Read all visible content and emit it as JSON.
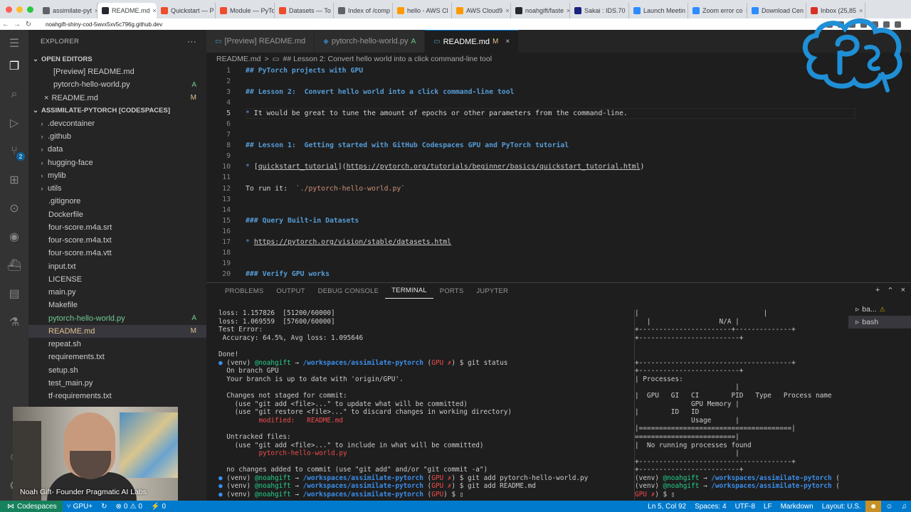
{
  "browser": {
    "tabs": [
      {
        "title": "assimilate-pyt",
        "color": "#5f6368"
      },
      {
        "title": "README.md",
        "color": "#24292f",
        "active": true
      },
      {
        "title": "Quickstart — P",
        "color": "#ee4c2c"
      },
      {
        "title": "Module — PyTo",
        "color": "#ee4c2c"
      },
      {
        "title": "Datasets — To",
        "color": "#ee4c2c"
      },
      {
        "title": "Index of /comp",
        "color": "#5f6368"
      },
      {
        "title": "hello - AWS Cl",
        "color": "#ff9900"
      },
      {
        "title": "AWS Cloud9",
        "color": "#ff9900"
      },
      {
        "title": "noahgift/faste",
        "color": "#24292f"
      },
      {
        "title": "Sakai : IDS.70",
        "color": "#1a237e"
      },
      {
        "title": "Launch Meetin",
        "color": "#2d8cff"
      },
      {
        "title": "Zoom error co",
        "color": "#2d8cff"
      },
      {
        "title": "Download Cen",
        "color": "#2d8cff"
      },
      {
        "title": "Inbox (25,85",
        "color": "#d93025"
      }
    ],
    "url": "noahgift-shiny-cod-5wvx5xv5c796g.github.dev"
  },
  "activity": {
    "source_control_badge": "2"
  },
  "explorer": {
    "title": "EXPLORER",
    "more": "···",
    "open_editors_label": "OPEN EDITORS",
    "open_editors": [
      {
        "name": "[Preview] README.md",
        "status": ""
      },
      {
        "name": "pytorch-hello-world.py",
        "status": "A"
      },
      {
        "name": "README.md",
        "status": "M",
        "close": "×"
      }
    ],
    "workspace_label": "ASSIMILATE-PYTORCH [CODESPACES]",
    "folders": [
      ".devcontainer",
      ".github",
      "data",
      "hugging-face",
      "mylib",
      "utils"
    ],
    "files": [
      {
        "name": ".gitignore",
        "status": ""
      },
      {
        "name": "Dockerfile",
        "status": ""
      },
      {
        "name": "four-score.m4a.srt",
        "status": ""
      },
      {
        "name": "four-score.m4a.txt",
        "status": ""
      },
      {
        "name": "four-score.m4a.vtt",
        "status": ""
      },
      {
        "name": "input.txt",
        "status": ""
      },
      {
        "name": "LICENSE",
        "status": ""
      },
      {
        "name": "main.py",
        "status": ""
      },
      {
        "name": "Makefile",
        "status": ""
      },
      {
        "name": "pytorch-hello-world.py",
        "status": "A"
      },
      {
        "name": "README.md",
        "status": "M"
      },
      {
        "name": "repeat.sh",
        "status": ""
      },
      {
        "name": "requirements.txt",
        "status": ""
      },
      {
        "name": "setup.sh",
        "status": ""
      },
      {
        "name": "test_main.py",
        "status": ""
      },
      {
        "name": "tf-requirements.txt",
        "status": ""
      }
    ]
  },
  "editor": {
    "tabs": [
      {
        "label": "[Preview] README.md",
        "mod": ""
      },
      {
        "label": "pytorch-hello-world.py",
        "mod": "A"
      },
      {
        "label": "README.md",
        "mod": "M",
        "active": true
      }
    ],
    "breadcrumb_file": "README.md",
    "breadcrumb_sep": ">",
    "breadcrumb_section": "## Lesson 2:  Convert hello world into a click command-line tool",
    "lines": [
      {
        "n": "1",
        "parts": [
          [
            "md-h",
            "## PyTorch projects with GPU"
          ]
        ]
      },
      {
        "n": "2",
        "parts": []
      },
      {
        "n": "3",
        "parts": [
          [
            "md-h",
            "## Lesson 2:  Convert hello world into a click command-line tool"
          ]
        ]
      },
      {
        "n": "4",
        "parts": []
      },
      {
        "n": "5",
        "parts": [
          [
            "md-b",
            "*"
          ],
          [
            "",
            " It would be great to tune the amount of epochs or other parameters from the command-line."
          ]
        ],
        "current": true
      },
      {
        "n": "6",
        "parts": []
      },
      {
        "n": "7",
        "parts": []
      },
      {
        "n": "8",
        "parts": [
          [
            "md-h",
            "## Lesson 1:  Getting started with GitHub Codespaces GPU and PyTorch tutorial"
          ]
        ]
      },
      {
        "n": "9",
        "parts": []
      },
      {
        "n": "10",
        "parts": [
          [
            "md-b",
            "*"
          ],
          [
            "",
            " ["
          ],
          [
            "md-link",
            "quickstart_tutorial"
          ],
          [
            "",
            "]("
          ],
          [
            "md-link",
            "https://pytorch.org/tutorials/beginner/basics/quickstart_tutorial.html"
          ],
          [
            "",
            ")"
          ]
        ]
      },
      {
        "n": "11",
        "parts": []
      },
      {
        "n": "12",
        "parts": [
          [
            "",
            "To run it:  "
          ],
          [
            "md-code",
            "`./pytorch-hello-world.py`"
          ]
        ]
      },
      {
        "n": "13",
        "parts": []
      },
      {
        "n": "14",
        "parts": []
      },
      {
        "n": "15",
        "parts": [
          [
            "md-h",
            "### Query Built-in Datasets"
          ]
        ]
      },
      {
        "n": "16",
        "parts": []
      },
      {
        "n": "17",
        "parts": [
          [
            "md-b",
            "*"
          ],
          [
            "",
            " "
          ],
          [
            "md-link",
            "https://pytorch.org/vision/stable/datasets.html"
          ]
        ]
      },
      {
        "n": "18",
        "parts": []
      },
      {
        "n": "19",
        "parts": []
      },
      {
        "n": "20",
        "parts": [
          [
            "md-h",
            "### Verify GPU works"
          ]
        ]
      }
    ]
  },
  "panel": {
    "tabs": [
      "PROBLEMS",
      "OUTPUT",
      "DEBUG CONSOLE",
      "TERMINAL",
      "PORTS",
      "JUPYTER"
    ],
    "active_tab": "TERMINAL",
    "terminal_left": [
      [
        [
          "",
          "loss: 1.157826  [51200/60000]"
        ]
      ],
      [
        [
          "",
          "loss: 1.069559  [57600/60000]"
        ]
      ],
      [
        [
          "",
          "Test Error:"
        ]
      ],
      [
        [
          "",
          " Accuracy: 64.5%, Avg loss: 1.095646"
        ]
      ],
      [
        [
          "",
          ""
        ]
      ],
      [
        [
          "",
          "Done!"
        ]
      ],
      [
        [
          "dot",
          "●"
        ],
        [
          "",
          " (venv) "
        ],
        [
          "t-green",
          "@noahgift"
        ],
        [
          "",
          " → "
        ],
        [
          "t-bold-blue",
          "/workspaces/assimilate-pytorch"
        ],
        [
          "",
          " ("
        ],
        [
          "t-red",
          "GPU ✗"
        ],
        [
          "",
          ") $ git status"
        ]
      ],
      [
        [
          "",
          "  On branch GPU"
        ]
      ],
      [
        [
          "",
          "  Your branch is up to date with 'origin/GPU'."
        ]
      ],
      [
        [
          "",
          ""
        ]
      ],
      [
        [
          "",
          "  Changes not staged for commit:"
        ]
      ],
      [
        [
          "",
          "    (use \"git add <file>...\" to update what will be committed)"
        ]
      ],
      [
        [
          "",
          "    (use \"git restore <file>...\" to discard changes in working directory)"
        ]
      ],
      [
        [
          "",
          "          "
        ],
        [
          "t-red",
          "modified:   README.md"
        ]
      ],
      [
        [
          "",
          ""
        ]
      ],
      [
        [
          "",
          "  Untracked files:"
        ]
      ],
      [
        [
          "",
          "    (use \"git add <file>...\" to include in what will be committed)"
        ]
      ],
      [
        [
          "",
          "          "
        ],
        [
          "t-red",
          "pytorch-hello-world.py"
        ]
      ],
      [
        [
          "",
          ""
        ]
      ],
      [
        [
          "",
          "  no changes added to commit (use \"git add\" and/or \"git commit -a\")"
        ]
      ],
      [
        [
          "dot",
          "●"
        ],
        [
          "",
          " (venv) "
        ],
        [
          "t-green",
          "@noahgift"
        ],
        [
          "",
          " → "
        ],
        [
          "t-bold-blue",
          "/workspaces/assimilate-pytorch"
        ],
        [
          "",
          " ("
        ],
        [
          "t-red",
          "GPU ✗"
        ],
        [
          "",
          ") $ git add pytorch-hello-world.py"
        ]
      ],
      [
        [
          "dot",
          "●"
        ],
        [
          "",
          " (venv) "
        ],
        [
          "t-green",
          "@noahgift"
        ],
        [
          "",
          " → "
        ],
        [
          "t-bold-blue",
          "/workspaces/assimilate-pytorch"
        ],
        [
          "",
          " ("
        ],
        [
          "t-red",
          "GPU ✗"
        ],
        [
          "",
          ") $ git add README.md"
        ]
      ],
      [
        [
          "dot",
          "●"
        ],
        [
          "",
          " (venv) "
        ],
        [
          "t-green",
          "@noahgift"
        ],
        [
          "",
          " → "
        ],
        [
          "t-bold-blue",
          "/workspaces/assimilate-pytorch"
        ],
        [
          "",
          " ("
        ],
        [
          "t-red",
          "GPU"
        ],
        [
          "",
          ") $ ▯"
        ]
      ]
    ],
    "terminal_right": [
      [
        [
          "",
          "|                               |"
        ]
      ],
      [
        [
          "",
          "   |                 N/A |"
        ]
      ],
      [
        [
          "",
          "+-----------------------+--------------+"
        ]
      ],
      [
        [
          "",
          "+-------------------------+"
        ]
      ],
      [
        [
          "",
          ""
        ]
      ],
      [
        [
          "",
          ""
        ]
      ],
      [
        [
          "",
          "+--------------------------------------+"
        ]
      ],
      [
        [
          "",
          "+-------------------------+"
        ]
      ],
      [
        [
          "",
          "| Processes:"
        ]
      ],
      [
        [
          "",
          "                         |"
        ]
      ],
      [
        [
          "",
          "|  GPU   GI   CI        PID   Type   Process name"
        ]
      ],
      [
        [
          "",
          "              GPU Memory |"
        ]
      ],
      [
        [
          "",
          "|        ID   ID"
        ]
      ],
      [
        [
          "",
          "              Usage      |"
        ]
      ],
      [
        [
          "",
          "|======================================|"
        ]
      ],
      [
        [
          "",
          "=========================|"
        ]
      ],
      [
        [
          "",
          "|  No running processes found"
        ]
      ],
      [
        [
          "",
          "                         |"
        ]
      ],
      [
        [
          "",
          "+--------------------------------------+"
        ]
      ],
      [
        [
          "",
          "+-------------------------+"
        ]
      ],
      [
        [
          "",
          "(venv) "
        ],
        [
          "t-green",
          "@noahgift"
        ],
        [
          "",
          " → "
        ],
        [
          "t-bold-blue",
          "/workspaces/assimilate-pytorch"
        ],
        [
          "",
          " ("
        ]
      ],
      [
        [
          "",
          "(venv) "
        ],
        [
          "t-green",
          "@noahgift"
        ],
        [
          "",
          " → "
        ],
        [
          "t-bold-blue",
          "/workspaces/assimilate-pytorch"
        ],
        [
          "",
          " ("
        ]
      ],
      [
        [
          "t-red",
          "GPU ✗"
        ],
        [
          "",
          ") $ ▯"
        ]
      ]
    ],
    "terminals": [
      {
        "label": "ba...",
        "warn": "⚠"
      },
      {
        "label": "bash",
        "warn": ""
      }
    ]
  },
  "statusbar": {
    "remote": "Codespaces",
    "branch": "GPU+",
    "errors": "0",
    "warnings": "0",
    "ports": "0",
    "cursor": "Ln 5, Col 92",
    "spaces": "Spaces: 4",
    "encoding": "UTF-8",
    "eol": "LF",
    "language": "Markdown",
    "layout": "Layout: U.S."
  },
  "webcam": {
    "caption": "Noah Gift- Founder Pragmatic AI Labs"
  },
  "colors": {
    "accent": "#007acc",
    "remote": "#16825d",
    "git_added": "#73c991",
    "git_modified": "#e2c08d",
    "logo_blue": "#1f8fd6"
  }
}
